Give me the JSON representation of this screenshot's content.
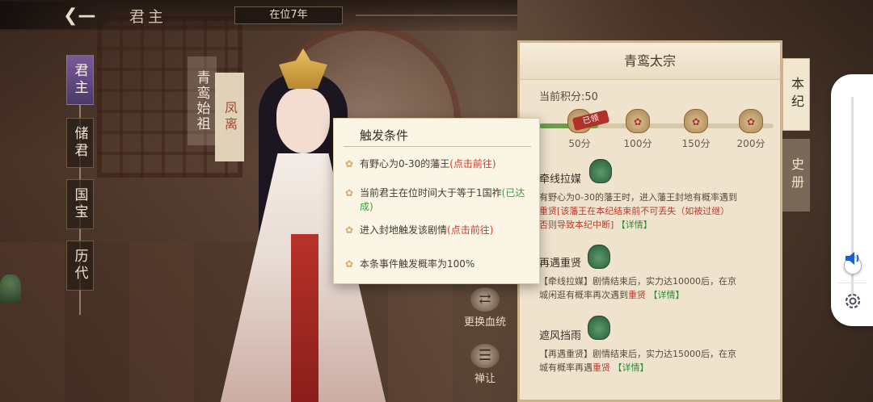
{
  "header": {
    "title": "君主",
    "reign": "在位7年"
  },
  "nav": {
    "items": [
      {
        "label": "君主",
        "active": true
      },
      {
        "label": "储君",
        "active": false
      },
      {
        "label": "国宝",
        "active": false
      },
      {
        "label": "历代",
        "active": false
      }
    ]
  },
  "character": {
    "lord_title": "青鸾始祖",
    "name": "凤离"
  },
  "actions": {
    "change_lineage": "更换血统",
    "abdicate": "禅让"
  },
  "panel": {
    "title": "青鸾太宗",
    "score_text": "当前积分:50",
    "score_progress": 0.25,
    "claimed_label": "已领",
    "milestones": [
      "50分",
      "100分",
      "150分",
      "200分"
    ],
    "events": [
      {
        "title": "牵线拉媒",
        "desc_a": "有野心为0-30的藩王时，进入藩王封地有概率遇到",
        "desc_b": "重贤[该藩王在本纪结束前不可丢失（如被过继）",
        "desc_c": "否则导致本纪中断]",
        "link": "【详情】"
      },
      {
        "title": "再遇重贤",
        "desc_a": "【牵线拉媒】剧情结束后，实力达10000后，在京",
        "desc_b": "城闲逛有概率再次遇到",
        "desc_hl": "重贤",
        "link": "【详情】"
      },
      {
        "title": "遮风挡雨",
        "desc_a": "【再遇重贤】剧情结束后，实力达15000后，在京",
        "desc_b": "城有概率再遇",
        "desc_hl": "重贤",
        "link": "【详情】"
      }
    ]
  },
  "side_tabs": {
    "annals": "本纪",
    "history": "史册"
  },
  "modal": {
    "title": "触发条件",
    "conditions": [
      {
        "text": "有野心为0-30的藩王",
        "action": "(点击前往)"
      },
      {
        "text": "当前君主在位时间大于等于1国祚",
        "action": "(已达成)"
      },
      {
        "text": "进入封地触发该剧情",
        "action": "(点击前往)"
      },
      {
        "text": "本条事件触发概率为100%",
        "action": ""
      }
    ]
  },
  "volume": {
    "level": 0.15
  },
  "colors": {
    "accent_red": "#d83a2a",
    "accent_green": "#3a9a3a",
    "panel_bg": "#efe3cd",
    "modal_bg": "#fbf5e6"
  }
}
